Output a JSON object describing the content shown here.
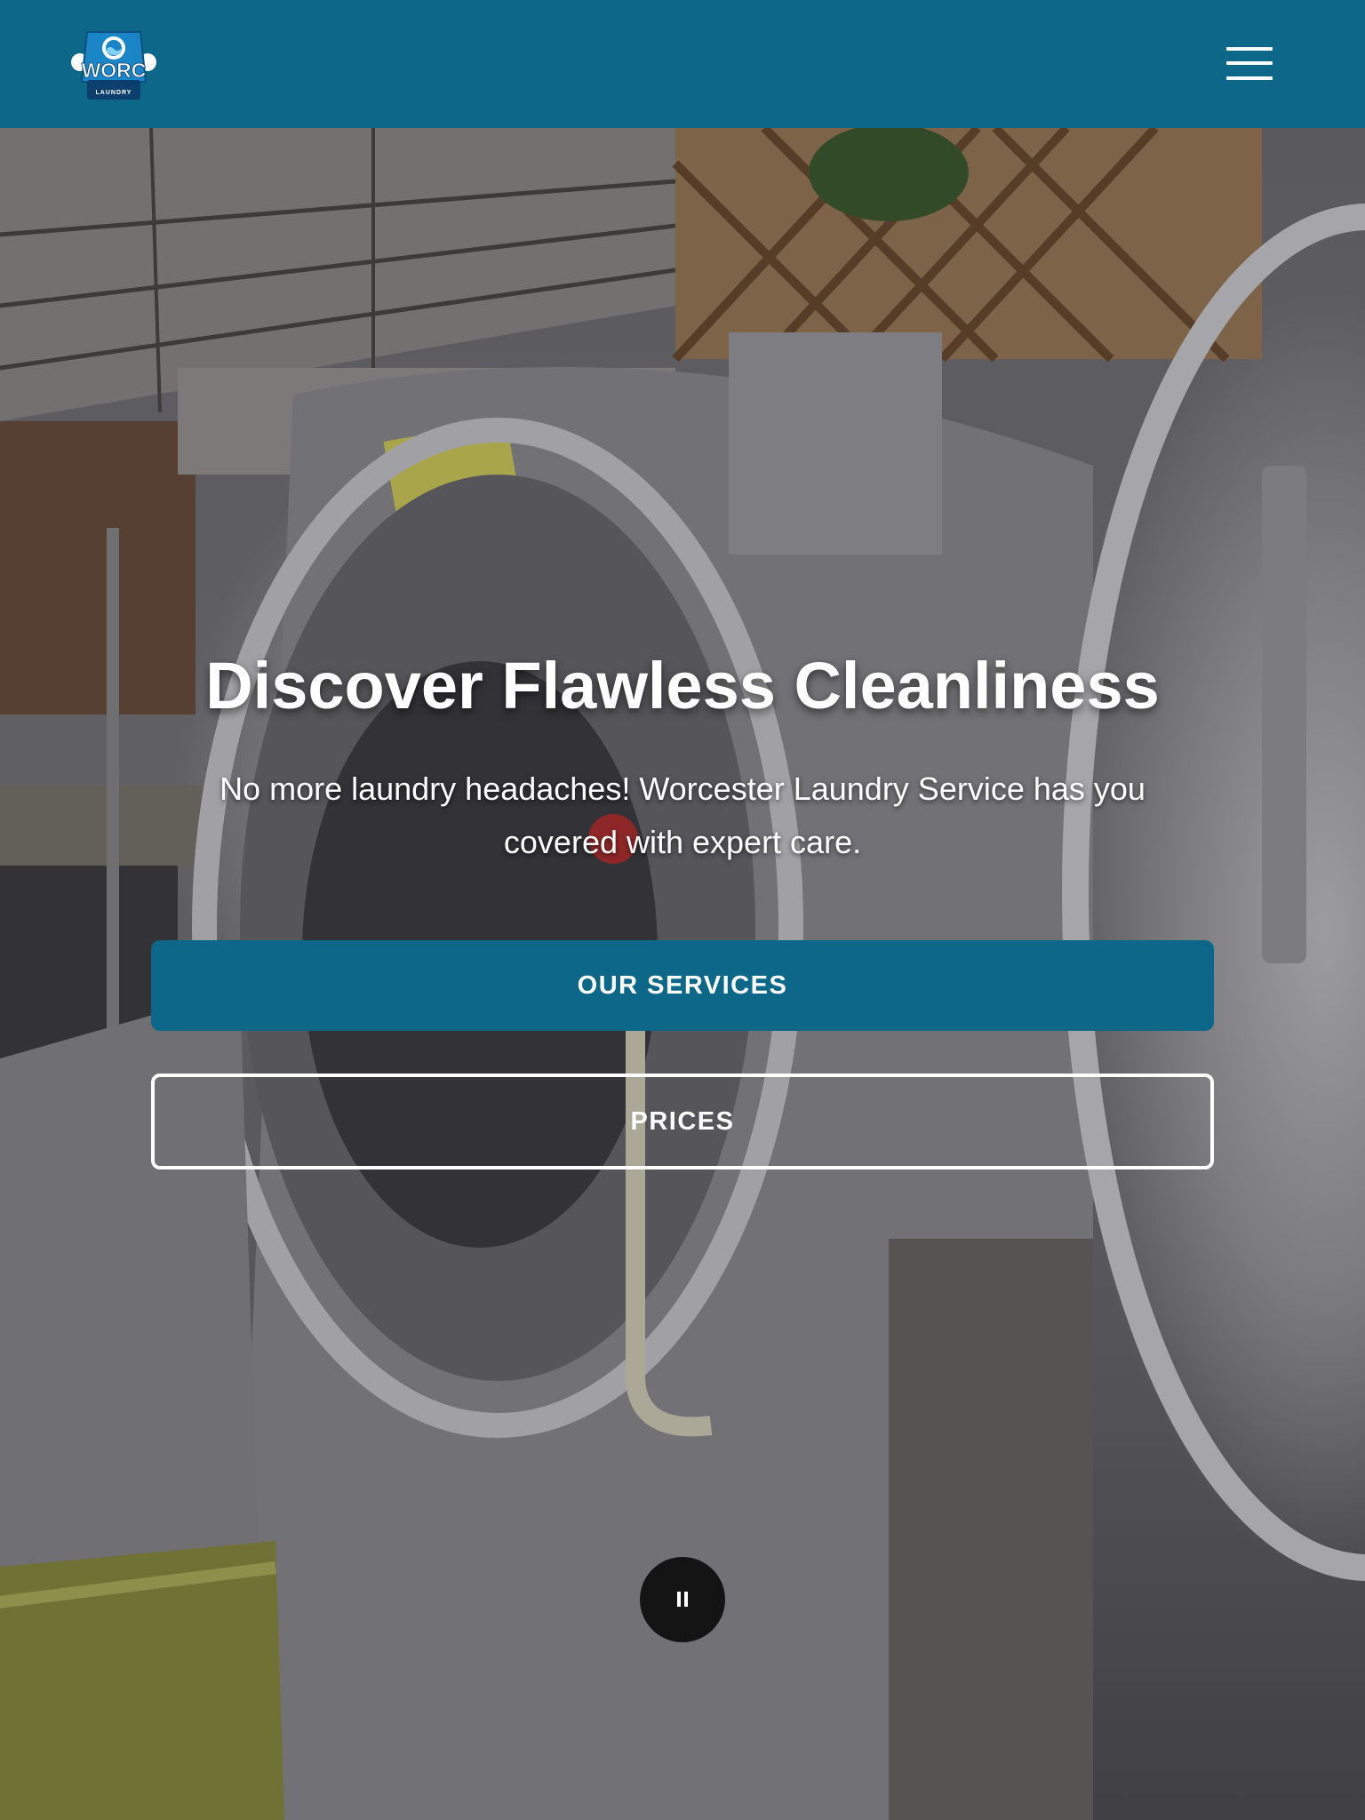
{
  "header": {
    "logo": {
      "text": "WORC",
      "subtext": "LAUNDRY",
      "icon": "washing-machine-logo-icon"
    },
    "menu_icon": "hamburger-menu-icon"
  },
  "hero": {
    "title": "Discover Flawless Cleanliness",
    "subtitle": "No more laundry headaches! Worcester Laundry Service has you covered with expert care.",
    "primary_button": "OUR SERVICES",
    "secondary_button": "PRICES",
    "media_control_icon": "pause-icon"
  },
  "colors": {
    "brand": "#0c6788",
    "text_on_brand": "#ffffff",
    "pause_button_bg": "#141414"
  }
}
